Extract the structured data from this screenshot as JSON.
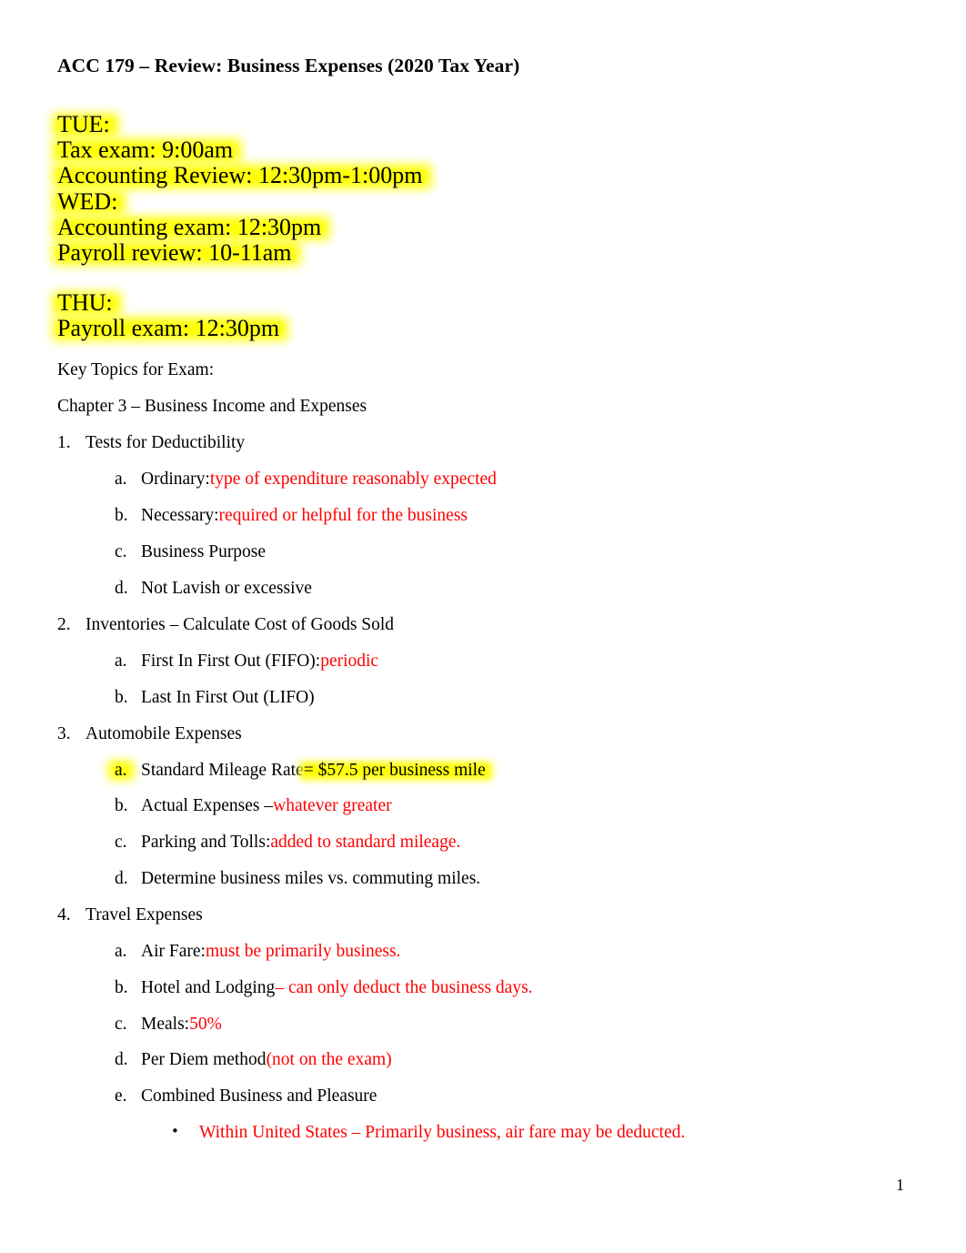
{
  "document": {
    "title": "ACC 179 – Review: Business Expenses (2020 Tax Year)",
    "page_number": "1",
    "highlight_color": "#ffff00",
    "accent_color": "#ff0000"
  },
  "schedule": {
    "block_a": [
      "TUE:",
      "Tax exam: 9:00am",
      "Accounting Review: 12:30pm-1:00pm",
      "WED:",
      "Accounting exam: 12:30pm",
      "Payroll review: 10-11am"
    ],
    "block_b": [
      "THU:",
      "Payroll exam: 12:30pm"
    ]
  },
  "intro": {
    "key_topics": "Key Topics for Exam:",
    "chapter": "Chapter 3 – Business Income and Expenses"
  },
  "outline": [
    {
      "marker": "1.",
      "text": "Tests for Deductibility",
      "children": [
        {
          "marker": "a.",
          "text": "Ordinary: ",
          "red": "type of expenditure reasonably expected"
        },
        {
          "marker": "b.",
          "text": "Necessary: ",
          "red": "required or helpful for the business"
        },
        {
          "marker": "c.",
          "text": "Business Purpose",
          "red": ""
        },
        {
          "marker": "d.",
          "text": "Not Lavish or excessive",
          "red": ""
        }
      ]
    },
    {
      "marker": "2.",
      "text": "Inventories – Calculate Cost of Goods Sold",
      "children": [
        {
          "marker": "a.",
          "text": "First In First Out (FIFO): ",
          "red": "periodic"
        },
        {
          "marker": "b.",
          "text": "Last In First Out (LIFO)",
          "red": ""
        }
      ]
    },
    {
      "marker": "3.",
      "text": "Automobile Expenses",
      "children": [
        {
          "marker": "a.",
          "text": "Standard Mileage Rate ",
          "highlighted": "= $57.5 per business mile",
          "red": ""
        },
        {
          "marker": "b.",
          "text": "Actual Expenses – ",
          "red": "whatever greater"
        },
        {
          "marker": "c.",
          "text": "Parking and Tolls: ",
          "red": "added to standard mileage."
        },
        {
          "marker": "d.",
          "text": "Determine business miles vs. commuting miles.",
          "red": ""
        }
      ]
    },
    {
      "marker": "4.",
      "text": "Travel Expenses",
      "children": [
        {
          "marker": "a.",
          "text": "Air Fare: ",
          "red": "must be primarily business."
        },
        {
          "marker": "b.",
          "text": "Hotel and Lodging ",
          "red": "– can only deduct the business days."
        },
        {
          "marker": "c.",
          "text": "Meals: ",
          "red": "50%"
        },
        {
          "marker": "d.",
          "text": "Per Diem method ",
          "red": "(not on the exam)"
        },
        {
          "marker": "e.",
          "text": "Combined Business and Pleasure",
          "red": ""
        }
      ]
    }
  ],
  "sub_bullet": {
    "marker": "•",
    "red": "Within United States – Primarily business, air fare may be deducted."
  }
}
